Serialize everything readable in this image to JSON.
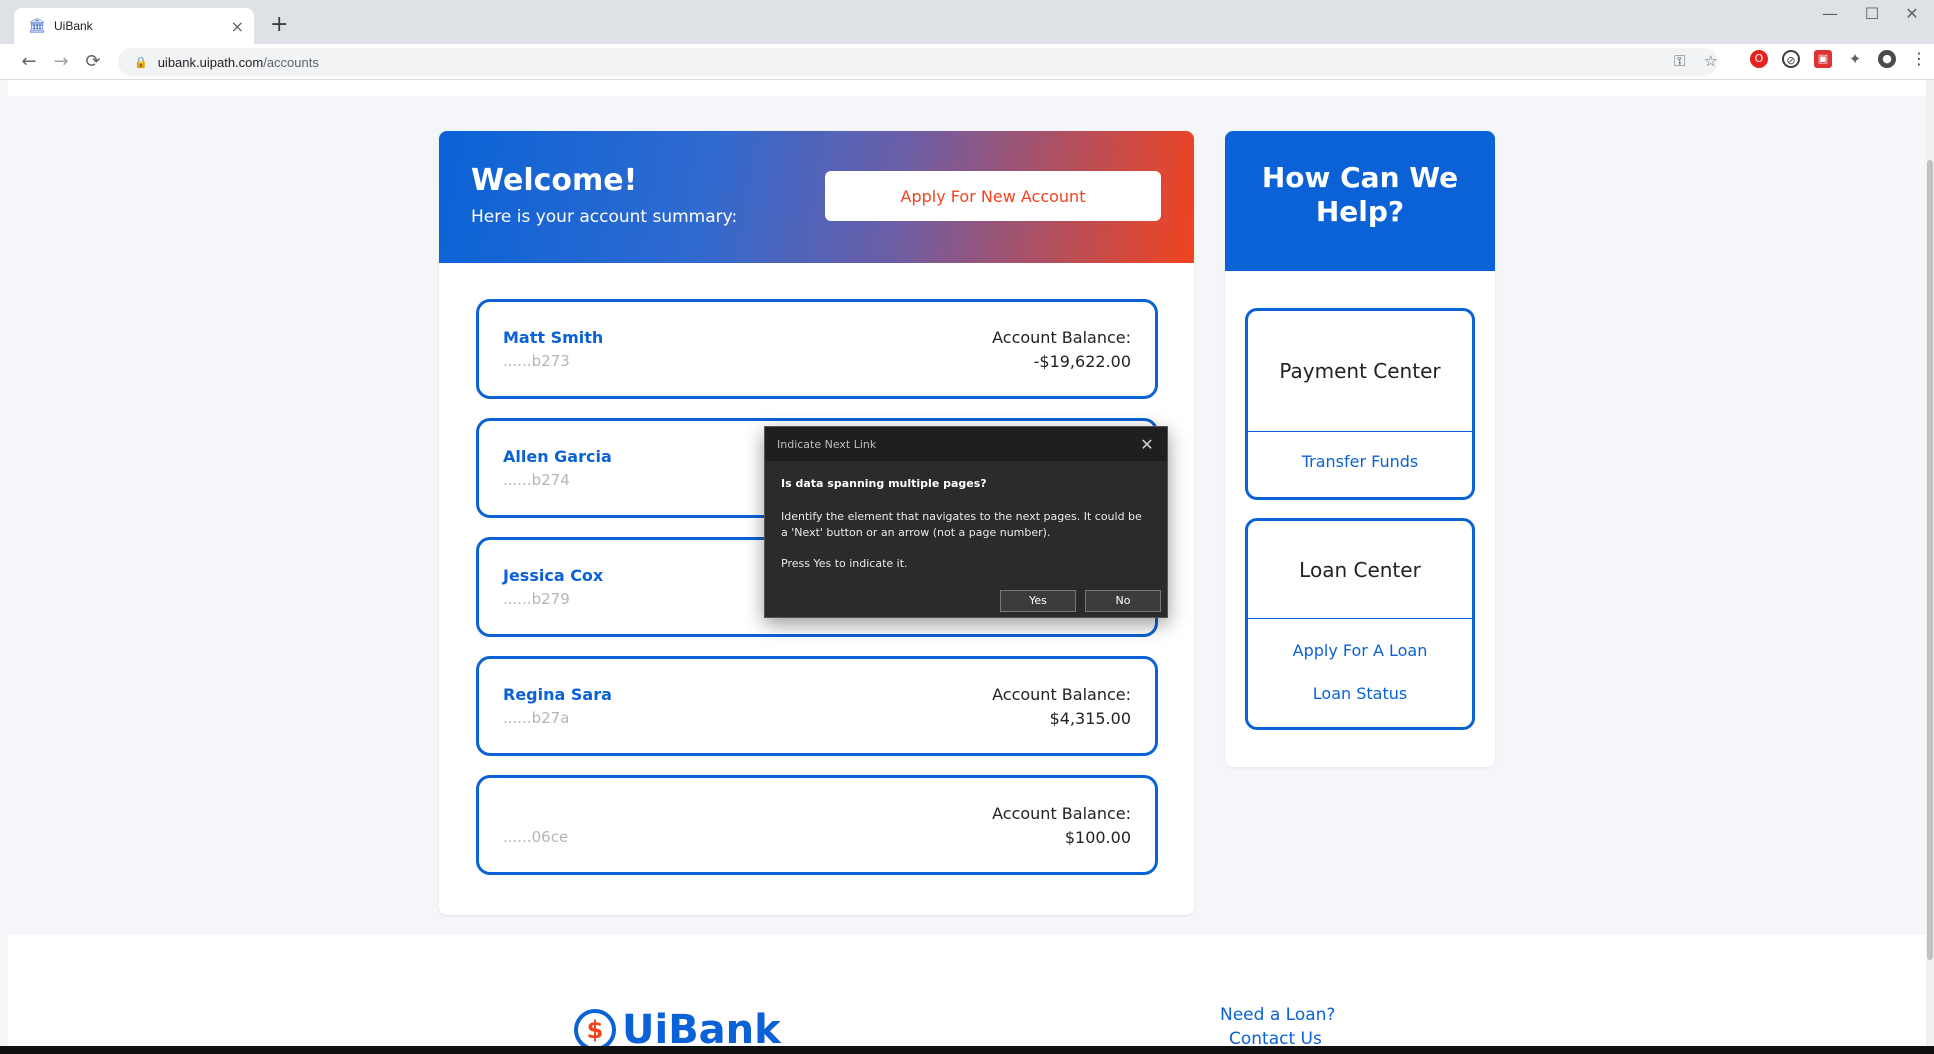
{
  "browser": {
    "tab_title": "UiBank",
    "new_tab": "+",
    "tab_close": "×",
    "url_host": "uibank.uipath.com",
    "url_path": "/accounts",
    "back": "←",
    "forward": "→",
    "reload": "⟳",
    "minimize": "—",
    "maximize": "☐",
    "close": "✕"
  },
  "welcome": {
    "title": "Welcome!",
    "subtitle": "Here is your account summary:",
    "apply_button": "Apply For New Account"
  },
  "accounts": [
    {
      "name": "Matt Smith",
      "number": "......b273",
      "balance_label": "Account Balance:",
      "balance": "-$19,622.00"
    },
    {
      "name": "Allen Garcia",
      "number": "......b274",
      "balance_label": "",
      "balance": ""
    },
    {
      "name": "Jessica Cox",
      "number": "......b279",
      "balance_label": "",
      "balance": ""
    },
    {
      "name": "Regina Sara",
      "number": "......b27a",
      "balance_label": "Account Balance:",
      "balance": "$4,315.00"
    },
    {
      "name": "",
      "number": "......06ce",
      "balance_label": "Account Balance:",
      "balance": "$100.00"
    }
  ],
  "help": {
    "title": "How Can We Help?",
    "payment_center": {
      "title": "Payment Center",
      "links": [
        "Transfer Funds"
      ]
    },
    "loan_center": {
      "title": "Loan Center",
      "links": [
        "Apply For A Loan",
        "Loan Status"
      ]
    }
  },
  "footer": {
    "logo_text": "UiBank",
    "logo_symbol": "$",
    "links": [
      "Need a Loan?",
      "Contact Us"
    ]
  },
  "dialog": {
    "title": "Indicate Next Link",
    "question": "Is data spanning multiple pages?",
    "body": "Identify the element that navigates to the next pages. It could be a 'Next' button or an arrow (not a page number).",
    "body2": "Press Yes to indicate it.",
    "yes": "Yes",
    "no": "No",
    "close": "✕"
  },
  "colors": {
    "brand_blue": "#0a62d6",
    "accent_orange": "#f1431e"
  }
}
